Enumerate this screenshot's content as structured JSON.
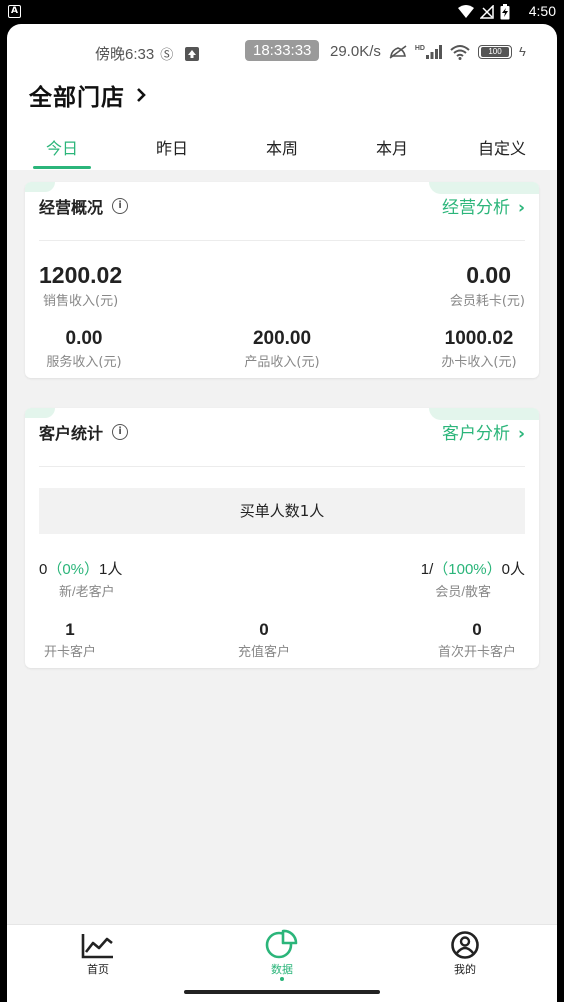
{
  "system_bar": {
    "badge": "A",
    "time": "4:50"
  },
  "inner_status": {
    "time_text": "傍晚6:33",
    "clock": "18:33:33",
    "speed": "29.0K/s",
    "hd": "HD",
    "battery": "100"
  },
  "header": {
    "store_title": "全部门店"
  },
  "tabs": [
    "今日",
    "昨日",
    "本周",
    "本月",
    "自定义"
  ],
  "active_tab": 0,
  "business": {
    "title": "经营概况",
    "link": "经营分析",
    "sales_value": "1200.02",
    "sales_label": "销售收入(元)",
    "member_value": "0.00",
    "member_label": "会员耗卡(元)",
    "service_value": "0.00",
    "service_label": "服务收入(元)",
    "product_value": "200.00",
    "product_label": "产品收入(元)",
    "card_value": "1000.02",
    "card_label": "办卡收入(元)"
  },
  "customers": {
    "title": "客户统计",
    "link": "客户分析",
    "buyers": "买单人数1人",
    "new_old_prefix": "0",
    "new_old_pct": "（0%）",
    "new_old_suffix": "1人",
    "new_old_label": "新/老客户",
    "member_prefix": "1/",
    "member_pct": "（100%）",
    "member_suffix": "0人",
    "member_label": "会员/散客",
    "open_value": "1",
    "open_label": "开卡客户",
    "recharge_value": "0",
    "recharge_label": "充值客户",
    "first_value": "0",
    "first_label": "首次开卡客户"
  },
  "nav": [
    {
      "label": "首页",
      "icon": "line-chart-icon"
    },
    {
      "label": "数据",
      "icon": "pie-chart-icon"
    },
    {
      "label": "我的",
      "icon": "profile-icon"
    }
  ],
  "colors": {
    "accent": "#2bb57a",
    "background": "#f2f2f2"
  }
}
